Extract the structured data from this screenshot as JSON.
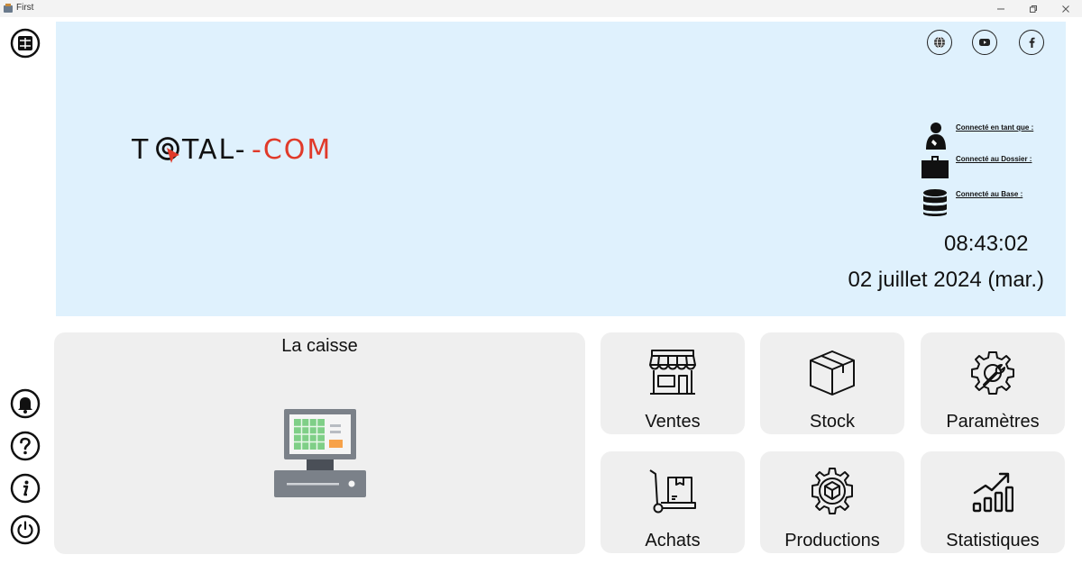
{
  "window": {
    "title": "First"
  },
  "sidebar": {
    "top_icon": "calculator-icon",
    "bottom_icons": [
      "bell-icon",
      "help-icon",
      "info-icon",
      "power-icon"
    ]
  },
  "banner": {
    "social_icons": [
      "globe-icon",
      "youtube-icon",
      "facebook-icon"
    ],
    "logo": {
      "part1": "T",
      "part2": "TAL-",
      "part3": "-COM"
    },
    "connection": {
      "user_label": "Connecté en tant que :",
      "folder_label": "Connecté au Dossier :",
      "base_label": "Connecté au Base :"
    },
    "time": "08:43:02",
    "date": "02 juillet 2024 (mar.)"
  },
  "tiles": {
    "caisse": "La caisse",
    "ventes": "Ventes",
    "stock": "Stock",
    "parametres": "Paramètres",
    "achats": "Achats",
    "productions": "Productions",
    "statistiques": "Statistiques"
  },
  "colors": {
    "banner_bg": "#dff1fd",
    "tile_bg": "#efefef",
    "logo_accent": "#e03a2a"
  }
}
